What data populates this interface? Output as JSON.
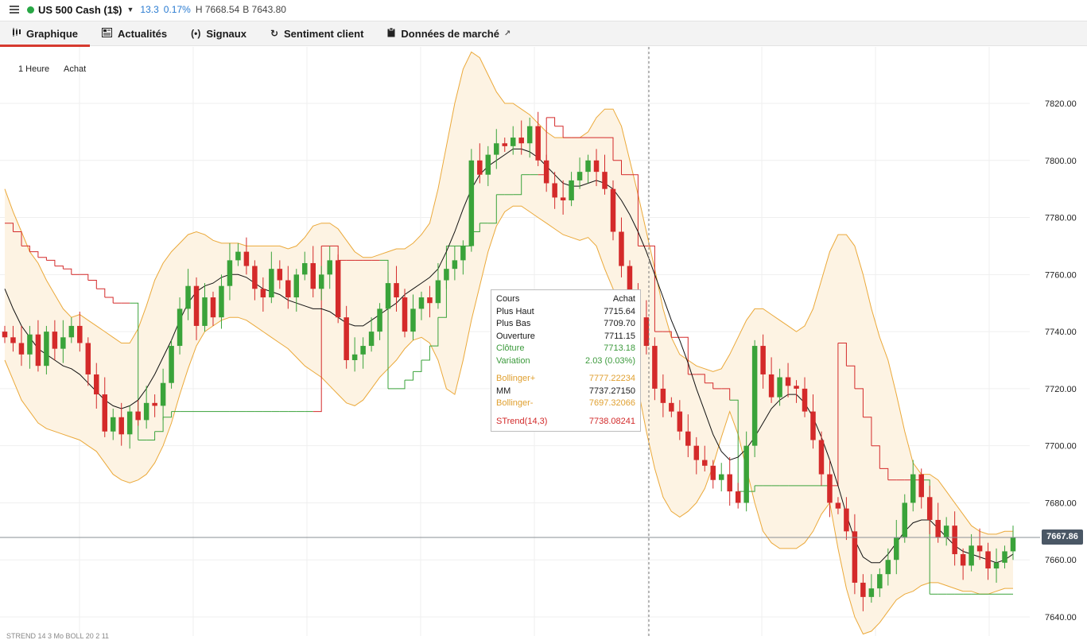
{
  "header": {
    "instrument": "US 500 Cash (1$)",
    "change": "13.3",
    "change_pct": "0.17%",
    "high": "H 7668.54",
    "bid": "B 7643.80"
  },
  "tabs": [
    {
      "label": "Graphique",
      "icon": "candles-icon",
      "active": true
    },
    {
      "label": "Actualités",
      "icon": "newspaper-icon",
      "active": false
    },
    {
      "label": "Signaux",
      "icon": "broadcast-icon",
      "active": false
    },
    {
      "label": "Sentiment client",
      "icon": "refresh-icon",
      "active": false
    },
    {
      "label": "Données de marché",
      "icon": "clipboard-icon",
      "active": false,
      "external": true
    }
  ],
  "toolbar": {
    "timeframe": "1 Heure",
    "price_type": "Achat"
  },
  "tooltip": {
    "title": "Cours",
    "title_value": "Achat",
    "rows": [
      {
        "label": "Plus Haut",
        "value": "7715.64",
        "color": "gray"
      },
      {
        "label": "Plus Bas",
        "value": "7709.70",
        "color": "gray"
      },
      {
        "label": "Ouverture",
        "value": "7711.15",
        "color": "gray"
      },
      {
        "label": "Clôture",
        "value": "7713.18",
        "color": "green"
      },
      {
        "label": "Variation",
        "value": "2.03 (0.03%)",
        "color": "green"
      }
    ],
    "indicators": [
      {
        "label": "Bollinger+",
        "value": "7777.22234",
        "color": "orange"
      },
      {
        "label": "MM",
        "value": "7737.27150",
        "color": "gray"
      },
      {
        "label": "Bollinger-",
        "value": "7697.32066",
        "color": "orange"
      }
    ],
    "strend": {
      "label": "STrend(14,3)",
      "value": "7738.08241",
      "color": "red"
    }
  },
  "current_price": "7667.86",
  "bottom_label": "STREND 14 3  Mo  BOLL 20  2  11",
  "colors": {
    "up": "#3aa33a",
    "down": "#d42a2a",
    "boll": "#eba93a",
    "boll_fill": "#fdf3e3",
    "mm": "#111111",
    "strend_up": "#3aa33a",
    "strend_down": "#d42a2a",
    "accent": "#d63a2f"
  },
  "chart_data": {
    "type": "line",
    "y_ticks": [
      "7820.00",
      "7800.00",
      "7780.00",
      "7760.00",
      "7740.00",
      "7720.00",
      "7700.00",
      "7680.00",
      "7660.00",
      "7640.00"
    ],
    "ylim": [
      7637,
      7835
    ],
    "close": [
      7738,
      7736,
      7732,
      7739,
      7728,
      7740,
      7734,
      7738,
      7742,
      7736,
      7725,
      7718,
      7705,
      7710,
      7704,
      7712,
      7709,
      7715,
      7714,
      7722,
      7735,
      7748,
      7756,
      7742,
      7752,
      7745,
      7756,
      7765,
      7768,
      7763,
      7755,
      7752,
      7762,
      7758,
      7752,
      7760,
      7764,
      7755,
      7760,
      7765,
      7745,
      7730,
      7732,
      7735,
      7740,
      7748,
      7757,
      7752,
      7740,
      7748,
      7752,
      7750,
      7758,
      7762,
      7765,
      7770,
      7800,
      7795,
      7802,
      7806,
      7805,
      7808,
      7806,
      7812,
      7800,
      7792,
      7787,
      7786,
      7793,
      7796,
      7800,
      7796,
      7790,
      7775,
      7763,
      7753,
      7745,
      7735,
      7720,
      7715,
      7712,
      7705,
      7700,
      7695,
      7693,
      7688,
      7690,
      7684,
      7680,
      7700,
      7735,
      7725,
      7717,
      7724,
      7721,
      7720,
      7712,
      7702,
      7690,
      7680,
      7678,
      7670,
      7652,
      7647,
      7650,
      7655,
      7660,
      7668,
      7680,
      7690,
      7682,
      7674,
      7668,
      7672,
      7662,
      7658,
      7665,
      7663,
      7657,
      7659,
      7663,
      7668
    ],
    "mm": [
      7755,
      7748,
      7742,
      7738,
      7734,
      7732,
      7730,
      7728,
      7727,
      7725,
      7722,
      7719,
      7716,
      7714,
      7713,
      7714,
      7716,
      7720,
      7725,
      7731,
      7737,
      7744,
      7750,
      7754,
      7756,
      7757,
      7759,
      7760,
      7760,
      7759,
      7757,
      7755,
      7754,
      7753,
      7751,
      7750,
      7749,
      7748,
      7748,
      7747,
      7745,
      7743,
      7742,
      7742,
      7744,
      7746,
      7748,
      7750,
      7753,
      7755,
      7757,
      7759,
      7762,
      7768,
      7775,
      7783,
      7790,
      7795,
      7798,
      7800,
      7802,
      7804,
      7804,
      7803,
      7801,
      7798,
      7795,
      7792,
      7791,
      7791,
      7792,
      7793,
      7792,
      7790,
      7786,
      7781,
      7775,
      7768,
      7760,
      7752,
      7744,
      7737,
      7729,
      7720,
      7712,
      7704,
      7698,
      7695,
      7696,
      7699,
      7703,
      7708,
      7713,
      7716,
      7718,
      7718,
      7715,
      7710,
      7703,
      7695,
      7686,
      7676,
      7667,
      7661,
      7659,
      7659,
      7662,
      7666,
      7670,
      7673,
      7674,
      7674,
      7671,
      7668,
      7665,
      7663,
      7662,
      7661,
      7660,
      7659,
      7660,
      7662
    ],
    "boll_upper": [
      7790,
      7782,
      7775,
      7768,
      7764,
      7758,
      7753,
      7748,
      7745,
      7746,
      7744,
      7742,
      7740,
      7738,
      7736,
      7736,
      7741,
      7749,
      7758,
      7764,
      7768,
      7771,
      7774,
      7775,
      7774,
      7772,
      7771,
      7771,
      7771,
      7770,
      7770,
      7770,
      7770,
      7770,
      7769,
      7770,
      7773,
      7777,
      7778,
      7778,
      7776,
      7772,
      7768,
      7766,
      7766,
      7767,
      7768,
      7769,
      7769,
      7771,
      7774,
      7778,
      7790,
      7805,
      7820,
      7832,
      7838,
      7836,
      7830,
      7824,
      7820,
      7820,
      7818,
      7816,
      7813,
      7810,
      7808,
      7808,
      7808,
      7808,
      7810,
      7815,
      7818,
      7818,
      7812,
      7800,
      7788,
      7775,
      7762,
      7748,
      7738,
      7732,
      7730,
      7728,
      7727,
      7726,
      7727,
      7732,
      7738,
      7744,
      7748,
      7748,
      7746,
      7744,
      7742,
      7740,
      7742,
      7748,
      7758,
      7768,
      7774,
      7774,
      7770,
      7760,
      7748,
      7738,
      7730,
      7718,
      7705,
      7694,
      7690,
      7690,
      7688,
      7684,
      7680,
      7676,
      7672,
      7670,
      7669,
      7669,
      7670,
      7670
    ],
    "boll_lower": [
      7730,
      7723,
      7716,
      7712,
      7708,
      7706,
      7705,
      7704,
      7703,
      7702,
      7700,
      7698,
      7694,
      7690,
      7688,
      7687,
      7688,
      7690,
      7694,
      7700,
      7708,
      7718,
      7727,
      7735,
      7740,
      7742,
      7744,
      7745,
      7745,
      7744,
      7742,
      7740,
      7738,
      7736,
      7734,
      7731,
      7728,
      7726,
      7724,
      7721,
      7718,
      7715,
      7714,
      7716,
      7720,
      7724,
      7727,
      7730,
      7734,
      7737,
      7738,
      7736,
      7730,
      7720,
      7718,
      7730,
      7744,
      7756,
      7768,
      7777,
      7782,
      7784,
      7784,
      7782,
      7780,
      7778,
      7776,
      7774,
      7773,
      7772,
      7773,
      7770,
      7762,
      7755,
      7745,
      7735,
      7720,
      7705,
      7692,
      7682,
      7677,
      7675,
      7677,
      7680,
      7685,
      7693,
      7703,
      7712,
      7704,
      7692,
      7680,
      7670,
      7666,
      7664,
      7664,
      7664,
      7666,
      7670,
      7676,
      7680,
      7664,
      7650,
      7640,
      7634,
      7635,
      7638,
      7642,
      7646,
      7648,
      7649,
      7651,
      7652,
      7652,
      7651,
      7650,
      7649,
      7649,
      7648,
      7648,
      7649,
      7650,
      7650
    ],
    "strend": [
      7778,
      7775,
      7770,
      7768,
      7766,
      7765,
      7763,
      7762,
      7760,
      7760,
      7758,
      7755,
      7752,
      7750,
      7750,
      7750,
      7702,
      7702,
      7705,
      7710,
      7712,
      7712,
      7712,
      7712,
      7712,
      7712,
      7712,
      7712,
      7712,
      7712,
      7712,
      7712,
      7712,
      7712,
      7712,
      7712,
      7712,
      7712,
      7770,
      7770,
      7765,
      7765,
      7765,
      7765,
      7765,
      7765,
      7720,
      7720,
      7723,
      7726,
      7730,
      7735,
      7745,
      7770,
      7770,
      7770,
      7775,
      7778,
      7778,
      7788,
      7788,
      7788,
      7795,
      7795,
      7795,
      7815,
      7812,
      7808,
      7808,
      7808,
      7808,
      7808,
      7808,
      7800,
      7795,
      7795,
      7770,
      7770,
      7740,
      7740,
      7738,
      7738,
      7725,
      7725,
      7722,
      7720,
      7720,
      7716,
      7684,
      7684,
      7686,
      7686,
      7686,
      7686,
      7686,
      7686,
      7686,
      7686,
      7686,
      7686,
      7736,
      7728,
      7720,
      7710,
      7700,
      7692,
      7688,
      7688,
      7688,
      7688,
      7688,
      7648,
      7648,
      7648,
      7648,
      7648,
      7648,
      7648,
      7648,
      7648,
      7648,
      7648
    ],
    "strend_dir": [
      "d",
      "d",
      "d",
      "d",
      "d",
      "d",
      "d",
      "d",
      "d",
      "d",
      "d",
      "d",
      "d",
      "d",
      "d",
      "d",
      "u",
      "u",
      "u",
      "u",
      "u",
      "u",
      "u",
      "u",
      "u",
      "u",
      "u",
      "u",
      "u",
      "u",
      "u",
      "u",
      "u",
      "u",
      "u",
      "u",
      "u",
      "u",
      "d",
      "d",
      "d",
      "d",
      "d",
      "d",
      "d",
      "d",
      "u",
      "u",
      "u",
      "u",
      "u",
      "u",
      "u",
      "u",
      "u",
      "u",
      "u",
      "u",
      "u",
      "u",
      "u",
      "u",
      "u",
      "u",
      "u",
      "d",
      "d",
      "d",
      "d",
      "d",
      "d",
      "d",
      "d",
      "d",
      "d",
      "d",
      "d",
      "d",
      "d",
      "d",
      "d",
      "d",
      "d",
      "d",
      "d",
      "d",
      "d",
      "d",
      "u",
      "u",
      "u",
      "u",
      "u",
      "u",
      "u",
      "u",
      "u",
      "u",
      "u",
      "u",
      "d",
      "d",
      "d",
      "d",
      "d",
      "d",
      "d",
      "d",
      "d",
      "d",
      "d",
      "u",
      "u",
      "u",
      "u",
      "u",
      "u",
      "u",
      "u",
      "u",
      "u",
      "u"
    ]
  }
}
